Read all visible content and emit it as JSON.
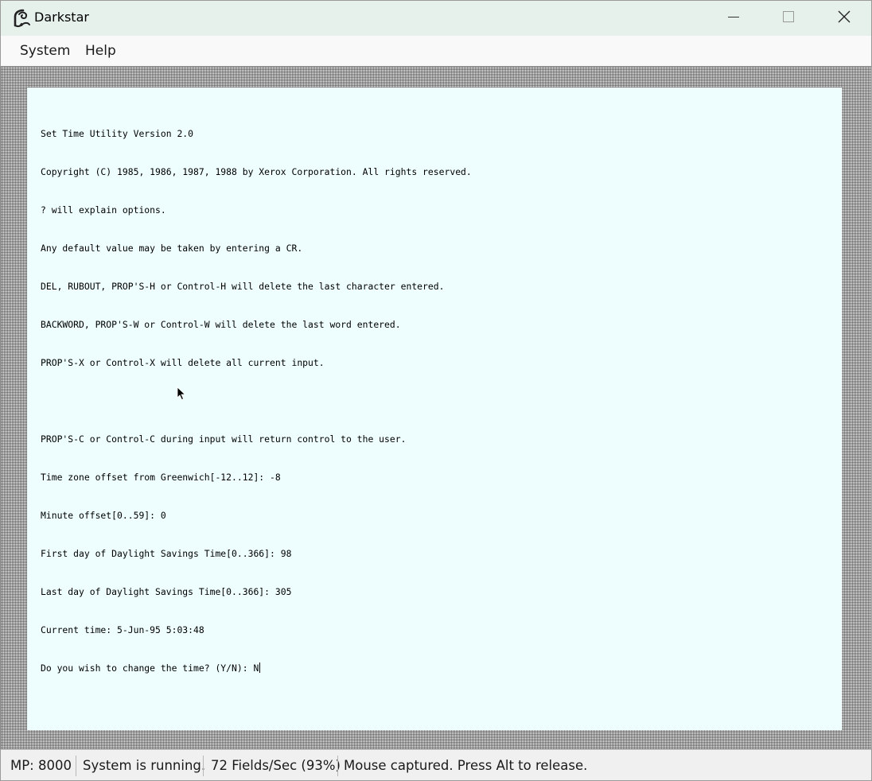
{
  "window": {
    "title": "Darkstar",
    "icons": {
      "app": "darkstar-app-icon",
      "minimize": "minimize-icon",
      "maximize": "maximize-icon",
      "close": "close-icon"
    }
  },
  "menu": {
    "items": [
      {
        "label": "System"
      },
      {
        "label": "Help"
      }
    ]
  },
  "terminal": {
    "lines": [
      "Set Time Utility Version 2.0",
      "Copyright (C) 1985, 1986, 1987, 1988 by Xerox Corporation. All rights reserved.",
      "? will explain options.",
      "Any default value may be taken by entering a CR.",
      "DEL, RUBOUT, PROP'S-H or Control-H will delete the last character entered.",
      "BACKWORD, PROP'S-W or Control-W will delete the last word entered.",
      "PROP'S-X or Control-X will delete all current input.",
      "",
      "PROP'S-C or Control-C during input will return control to the user.",
      "Time zone offset from Greenwich[-12..12]: -8",
      "Minute offset[0..59]: 0",
      "First day of Daylight Savings Time[0..366]: 98",
      "Last day of Daylight Savings Time[0..366]: 305",
      "Current time: 5-Jun-95 5:03:48",
      "Do you wish to change the time? (Y/N): N"
    ],
    "cursor_icon": "mouse-pointer-icon"
  },
  "status": {
    "mp": "MP: 8000",
    "state": "System is running.",
    "fields": "72 Fields/Sec (93%)",
    "mouse": "Mouse captured.  Press Alt to release."
  },
  "colors": {
    "titlebar": "#e7f1ec",
    "screen": "#eefefe",
    "statusbar": "#f0f0f0"
  }
}
